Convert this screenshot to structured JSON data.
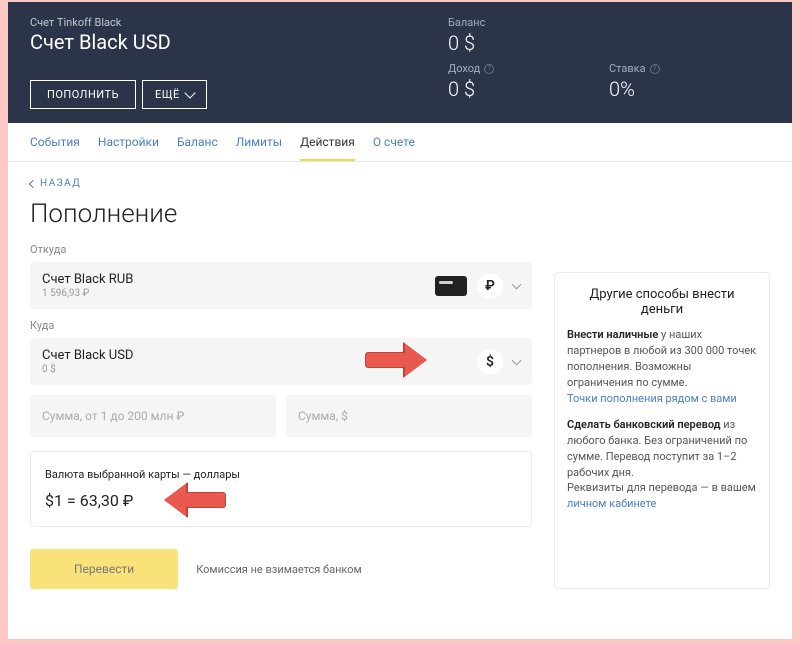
{
  "header": {
    "account_label": "Счет Tinkoff Black",
    "account_title": "Счет Black USD",
    "btn_deposit": "ПОПОЛНИТЬ",
    "btn_more": "ЕЩЁ",
    "stats": {
      "balance_label": "Баланс",
      "balance_value": "0 $",
      "income_label": "Доход",
      "income_value": "0 $",
      "rate_label": "Ставка",
      "rate_value": "0%"
    }
  },
  "tabs": [
    "События",
    "Настройки",
    "Баланс",
    "Лимиты",
    "Действия",
    "О счете"
  ],
  "active_tab_index": 4,
  "back_label": "НАЗАД",
  "page_title": "Пополнение",
  "from_label": "Откуда",
  "to_label": "Куда",
  "from": {
    "title": "Счет Black RUB",
    "sub": "1 596,93 ₽",
    "currency": "₽"
  },
  "to": {
    "title": "Счет Black USD",
    "sub": "0 $",
    "currency": "$"
  },
  "amount_rub_ph": "Сумма, от 1 до 200 млн ₽",
  "amount_usd_ph": "Сумма, $",
  "rate_caption": "Валюта выбранной карты — доллары",
  "rate_value": "$1 = 63,30 ₽",
  "btn_submit": "Перевести",
  "fee_note": "Комиссия не взимается банком",
  "side": {
    "title": "Другие способы внести деньги",
    "block1_b": "Внести наличные",
    "block1_t": " у наших партнеров в любой из 300 000 точек пополнения. Возможны ограничения по сумме.",
    "block1_link": "Точки пополнения рядом с вами",
    "block2_b": "Сделать банковский перевод",
    "block2_t": " из любого банка. Без ограничений по сумме. Перевод поступит за 1–2 рабочих дня.",
    "block2_tail": "Реквизиты для перевода — в вашем ",
    "block2_link": "личном кабинете"
  }
}
